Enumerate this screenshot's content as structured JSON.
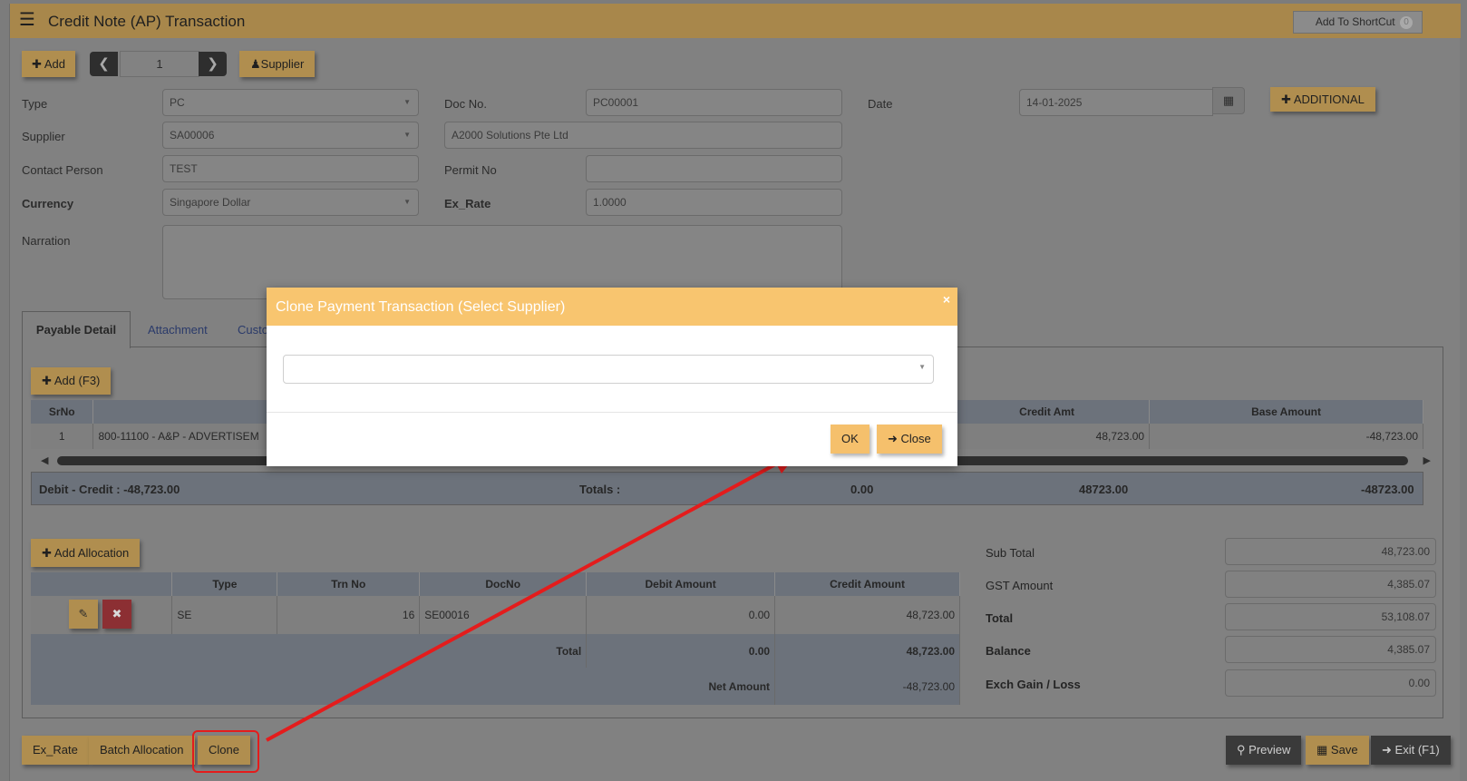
{
  "header": {
    "title": "Credit Note (AP) Transaction",
    "shortcut_label": "Add To ShortCut",
    "shortcut_count": "0"
  },
  "toolbar": {
    "add": "Add",
    "page_number": "1",
    "supplier": "Supplier",
    "additional": "ADDITIONAL"
  },
  "form": {
    "type_label": "Type",
    "type_value": "PC",
    "docno_label": "Doc No.",
    "docno_value": "PC00001",
    "date_label": "Date",
    "date_value": "14-01-2025",
    "supplier_label": "Supplier",
    "supplier_value": "SA00006",
    "supplier_name": "A2000 Solutions Pte Ltd",
    "contact_label": "Contact Person",
    "contact_value": "TEST",
    "permit_label": "Permit No",
    "permit_value": "",
    "currency_label": "Currency",
    "currency_value": "Singapore Dollar",
    "exrate_label": "Ex_Rate",
    "exrate_value": "1.0000",
    "narration_label": "Narration",
    "narration_value": ""
  },
  "tabs": [
    "Payable Detail",
    "Attachment",
    "Custo"
  ],
  "payable": {
    "add_label": "Add (F3)",
    "columns": [
      "SrNo",
      "Credit Amt",
      "Base Amount"
    ],
    "rows": [
      {
        "srno": "1",
        "account": "800-11100 - A&P - ADVERTISEM",
        "credit": "48,723.00",
        "base": "-48,723.00"
      }
    ],
    "debit_credit": "Debit - Credit : -48,723.00",
    "totals_label": "Totals :",
    "total_debit": "0.00",
    "total_credit": "48723.00",
    "total_base": "-48723.00"
  },
  "allocation": {
    "add_label": "Add Allocation",
    "columns": [
      "",
      "Type",
      "Trn No",
      "DocNo",
      "Debit Amount",
      "Credit Amount"
    ],
    "rows": [
      {
        "type": "SE",
        "trn_no": "16",
        "docno": "SE00016",
        "debit": "0.00",
        "credit": "48,723.00"
      }
    ],
    "total_label": "Total",
    "total_debit": "0.00",
    "total_credit": "48,723.00",
    "net_label": "Net Amount",
    "net_value": "-48,723.00"
  },
  "summary": {
    "subtotal_label": "Sub Total",
    "subtotal": "48,723.00",
    "gst_label": "GST Amount",
    "gst": "4,385.07",
    "total_label": "Total",
    "total": "53,108.07",
    "balance_label": "Balance",
    "balance": "4,385.07",
    "exch_label": "Exch Gain / Loss",
    "exch": "0.00"
  },
  "footer": {
    "exrate": "Ex_Rate",
    "batch": "Batch Allocation",
    "clone": "Clone",
    "preview": "Preview",
    "save": "Save",
    "exit": "Exit (F1)"
  },
  "modal": {
    "title": "Clone Payment Transaction (Select Supplier)",
    "select_value": "",
    "ok": "OK",
    "close": "Close"
  },
  "colors": {
    "accent": "#f8c56f",
    "annotation": "#e41c1c",
    "overlay_header": "#a8874b"
  }
}
